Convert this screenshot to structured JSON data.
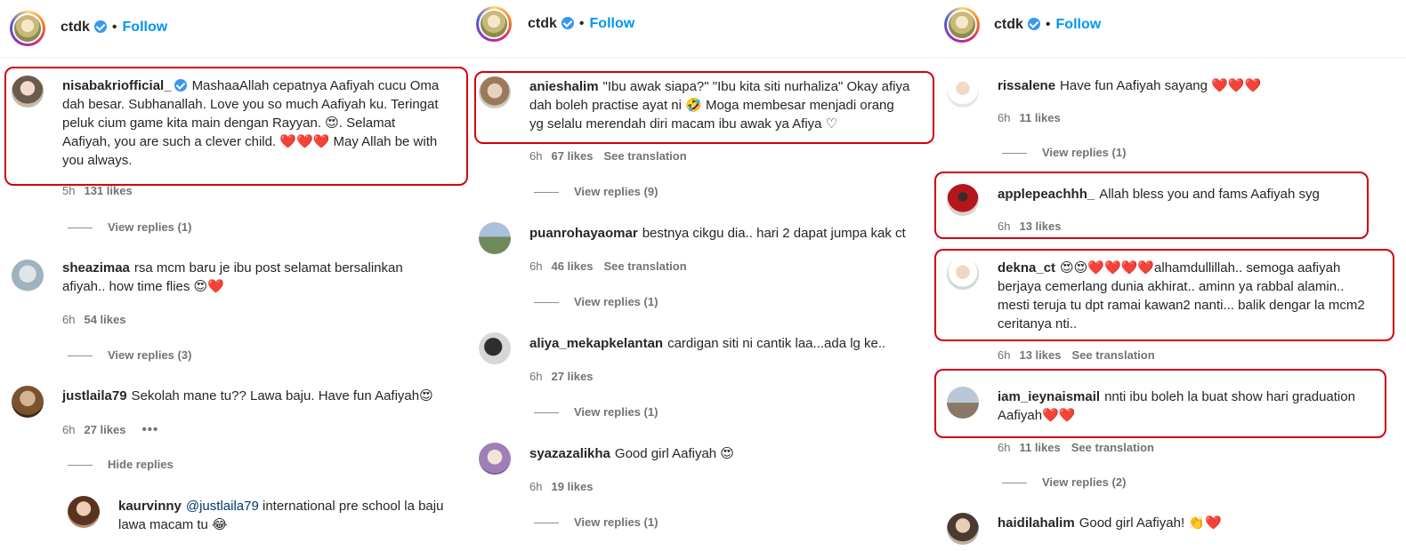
{
  "panels": [
    {
      "header": {
        "username": "ctdk",
        "separator": "•",
        "follow": "Follow"
      },
      "comments": [
        {
          "username": "nisabakriofficial_",
          "lines": [
            "MashaaAllah cepatnya Aafiyah cucu Oma",
            "dah besar. Subhanallah. Love you so much Aafiyah ku. Teringat",
            "peluk cium game kita main dengan Rayyan. 😍. Selamat",
            "Aafiyah, you are such a clever child. ❤️❤️❤️ May Allah be with",
            "you always."
          ],
          "time": "5h",
          "likes": "131 likes",
          "replies": "View replies (1)"
        },
        {
          "username": "sheazimaa",
          "lines": [
            "rsa mcm baru je ibu post selamat bersalinkan",
            "afiyah.. how time flies 😍❤️"
          ],
          "time": "6h",
          "likes": "54 likes",
          "replies": "View replies (3)"
        },
        {
          "username": "justlaila79",
          "lines": [
            "Sekolah mane tu?? Lawa baju. Have fun Aafiyah😍"
          ],
          "time": "6h",
          "likes": "27 likes",
          "more": "•••",
          "replies": "Hide replies"
        },
        {
          "username": "kaurvinny",
          "mention": "@justlaila79",
          "lines": [
            "international pre school la baju",
            "lawa macam tu 😂"
          ]
        }
      ]
    },
    {
      "header": {
        "username": "ctdk",
        "separator": "•",
        "follow": "Follow"
      },
      "comments": [
        {
          "username": "anieshalim",
          "lines": [
            "\"Ibu awak siapa?\" \"Ibu kita siti nurhaliza\" Okay afiya",
            "dah boleh practise ayat ni 🤣 Moga membesar menjadi orang",
            "yg selalu merendah diri macam ibu awak ya Afiya ♡"
          ],
          "time": "6h",
          "likes": "67 likes",
          "translation": "See translation",
          "replies": "View replies (9)"
        },
        {
          "username": "puanrohayaomar",
          "lines": [
            "bestnya cikgu dia.. hari 2 dapat jumpa kak ct"
          ],
          "time": "6h",
          "likes": "46 likes",
          "translation": "See translation",
          "replies": "View replies (1)"
        },
        {
          "username": "aliya_mekapkelantan",
          "lines": [
            "cardigan siti ni cantik laa...ada lg ke.."
          ],
          "time": "6h",
          "likes": "27 likes",
          "replies": "View replies (1)"
        },
        {
          "username": "syazazalikha",
          "lines": [
            "Good girl Aafiyah 😍"
          ],
          "time": "6h",
          "likes": "19 likes",
          "replies": "View replies (1)"
        }
      ]
    },
    {
      "header": {
        "username": "ctdk",
        "separator": "•",
        "follow": "Follow"
      },
      "comments": [
        {
          "username": "rissalene",
          "lines": [
            "Have fun Aafiyah sayang ❤️❤️❤️"
          ],
          "time": "6h",
          "likes": "11 likes",
          "replies": "View replies (1)"
        },
        {
          "username": "applepeachhh_",
          "lines": [
            "Allah bless you and fams Aafiyah syg"
          ],
          "time": "6h",
          "likes": "13 likes"
        },
        {
          "username": "dekna_ct",
          "lines": [
            "😍😍❤️❤️❤️❤️alhamdullillah.. semoga aafiyah",
            "berjaya cemerlang dunia akhirat.. aminn ya rabbal alamin..",
            "mesti teruja tu dpt ramai kawan2 nanti... balik dengar la mcm2",
            "ceritanya nti.."
          ],
          "time": "6h",
          "likes": "13 likes",
          "translation": "See translation"
        },
        {
          "username": "iam_ieynaismail",
          "lines": [
            "nnti ibu boleh la buat show hari graduation",
            "Aafiyah❤️❤️"
          ],
          "time": "6h",
          "likes": "11 likes",
          "translation": "See translation",
          "replies": "View replies (2)"
        },
        {
          "username": "haidilahalim",
          "lines": [
            "Good girl Aafiyah! 👏❤️"
          ]
        }
      ]
    }
  ],
  "colors": {
    "link": "#0095f6",
    "highlight": "#d4000f",
    "meta": "#737373",
    "text": "#262626"
  }
}
